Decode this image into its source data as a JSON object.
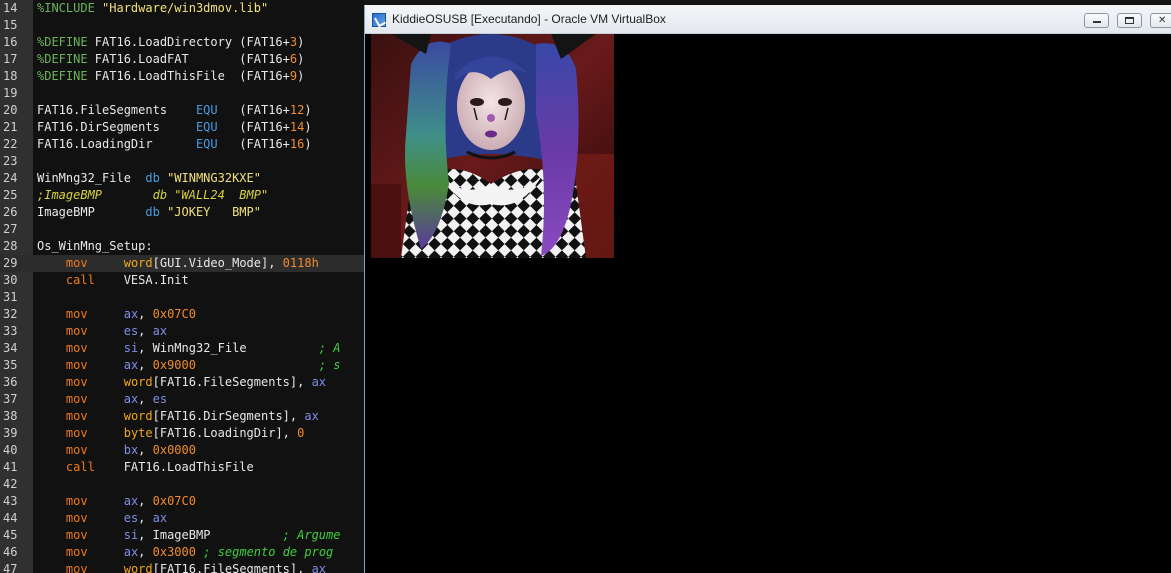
{
  "editor": {
    "lines": [
      {
        "num": "14",
        "current": false,
        "tokens": [
          {
            "t": "%INCLUDE",
            "c": "t-dir"
          },
          {
            "t": " ",
            "c": "t-plain"
          },
          {
            "t": "\"Hardware/win3dmov.lib\"",
            "c": "t-str"
          }
        ]
      },
      {
        "num": "15",
        "current": false,
        "tokens": []
      },
      {
        "num": "16",
        "current": false,
        "tokens": [
          {
            "t": "%DEFINE",
            "c": "t-dir"
          },
          {
            "t": " FAT16.LoadDirectory (FAT16+",
            "c": "t-plain"
          },
          {
            "t": "3",
            "c": "t-num"
          },
          {
            "t": ")",
            "c": "t-plain"
          }
        ]
      },
      {
        "num": "17",
        "current": false,
        "tokens": [
          {
            "t": "%DEFINE",
            "c": "t-dir"
          },
          {
            "t": " FAT16.LoadFAT       (FAT16+",
            "c": "t-plain"
          },
          {
            "t": "6",
            "c": "t-num"
          },
          {
            "t": ")",
            "c": "t-plain"
          }
        ]
      },
      {
        "num": "18",
        "current": false,
        "tokens": [
          {
            "t": "%DEFINE",
            "c": "t-dir"
          },
          {
            "t": " FAT16.LoadThisFile  (FAT16+",
            "c": "t-plain"
          },
          {
            "t": "9",
            "c": "t-num"
          },
          {
            "t": ")",
            "c": "t-plain"
          }
        ]
      },
      {
        "num": "19",
        "current": false,
        "tokens": []
      },
      {
        "num": "20",
        "current": false,
        "tokens": [
          {
            "t": "FAT16.FileSegments    ",
            "c": "t-plain"
          },
          {
            "t": "EQU",
            "c": "t-kw"
          },
          {
            "t": "   (FAT16+",
            "c": "t-plain"
          },
          {
            "t": "12",
            "c": "t-num"
          },
          {
            "t": ")",
            "c": "t-plain"
          }
        ]
      },
      {
        "num": "21",
        "current": false,
        "tokens": [
          {
            "t": "FAT16.DirSegments     ",
            "c": "t-plain"
          },
          {
            "t": "EQU",
            "c": "t-kw"
          },
          {
            "t": "   (FAT16+",
            "c": "t-plain"
          },
          {
            "t": "14",
            "c": "t-num"
          },
          {
            "t": ")",
            "c": "t-plain"
          }
        ]
      },
      {
        "num": "22",
        "current": false,
        "tokens": [
          {
            "t": "FAT16.LoadingDir      ",
            "c": "t-plain"
          },
          {
            "t": "EQU",
            "c": "t-kw"
          },
          {
            "t": "   (FAT16+",
            "c": "t-plain"
          },
          {
            "t": "16",
            "c": "t-num"
          },
          {
            "t": ")",
            "c": "t-plain"
          }
        ]
      },
      {
        "num": "23",
        "current": false,
        "tokens": []
      },
      {
        "num": "24",
        "current": false,
        "tokens": [
          {
            "t": "WinMng32_File  ",
            "c": "t-plain"
          },
          {
            "t": "db",
            "c": "t-kw"
          },
          {
            "t": " ",
            "c": "t-plain"
          },
          {
            "t": "\"WINMNG32KXE\"",
            "c": "t-str"
          }
        ]
      },
      {
        "num": "25",
        "current": false,
        "tokens": [
          {
            "t": ";ImageBMP       db \"WALL24  BMP\"",
            "c": "t-icmt"
          }
        ]
      },
      {
        "num": "26",
        "current": false,
        "tokens": [
          {
            "t": "ImageBMP       ",
            "c": "t-plain"
          },
          {
            "t": "db",
            "c": "t-kw"
          },
          {
            "t": " ",
            "c": "t-plain"
          },
          {
            "t": "\"JOKEY   BMP\"",
            "c": "t-str"
          }
        ]
      },
      {
        "num": "27",
        "current": false,
        "tokens": []
      },
      {
        "num": "28",
        "current": false,
        "tokens": [
          {
            "t": "Os_WinMng_Setup:",
            "c": "t-plain"
          }
        ]
      },
      {
        "num": "29",
        "current": true,
        "tokens": [
          {
            "t": "    ",
            "c": "t-plain"
          },
          {
            "t": "mov",
            "c": "t-op"
          },
          {
            "t": "     ",
            "c": "t-plain"
          },
          {
            "t": "word",
            "c": "t-word"
          },
          {
            "t": "[GUI.Video_Mode], ",
            "c": "t-plain"
          },
          {
            "t": "0118h",
            "c": "t-num"
          }
        ]
      },
      {
        "num": "30",
        "current": false,
        "tokens": [
          {
            "t": "    ",
            "c": "t-plain"
          },
          {
            "t": "call",
            "c": "t-op"
          },
          {
            "t": "    VESA.Init",
            "c": "t-plain"
          }
        ]
      },
      {
        "num": "31",
        "current": false,
        "tokens": []
      },
      {
        "num": "32",
        "current": false,
        "tokens": [
          {
            "t": "    ",
            "c": "t-plain"
          },
          {
            "t": "mov",
            "c": "t-op"
          },
          {
            "t": "     ",
            "c": "t-plain"
          },
          {
            "t": "ax",
            "c": "t-reg"
          },
          {
            "t": ", ",
            "c": "t-plain"
          },
          {
            "t": "0x07C0",
            "c": "t-num"
          }
        ]
      },
      {
        "num": "33",
        "current": false,
        "tokens": [
          {
            "t": "    ",
            "c": "t-plain"
          },
          {
            "t": "mov",
            "c": "t-op"
          },
          {
            "t": "     ",
            "c": "t-plain"
          },
          {
            "t": "es",
            "c": "t-reg"
          },
          {
            "t": ", ",
            "c": "t-plain"
          },
          {
            "t": "ax",
            "c": "t-reg"
          }
        ]
      },
      {
        "num": "34",
        "current": false,
        "tokens": [
          {
            "t": "    ",
            "c": "t-plain"
          },
          {
            "t": "mov",
            "c": "t-op"
          },
          {
            "t": "     ",
            "c": "t-plain"
          },
          {
            "t": "si",
            "c": "t-reg"
          },
          {
            "t": ", WinMng32_File          ",
            "c": "t-plain"
          },
          {
            "t": "; A",
            "c": "t-cmt"
          }
        ]
      },
      {
        "num": "35",
        "current": false,
        "tokens": [
          {
            "t": "    ",
            "c": "t-plain"
          },
          {
            "t": "mov",
            "c": "t-op"
          },
          {
            "t": "     ",
            "c": "t-plain"
          },
          {
            "t": "ax",
            "c": "t-reg"
          },
          {
            "t": ", ",
            "c": "t-plain"
          },
          {
            "t": "0x9000",
            "c": "t-num"
          },
          {
            "t": "                 ",
            "c": "t-plain"
          },
          {
            "t": "; s",
            "c": "t-cmt"
          }
        ]
      },
      {
        "num": "36",
        "current": false,
        "tokens": [
          {
            "t": "    ",
            "c": "t-plain"
          },
          {
            "t": "mov",
            "c": "t-op"
          },
          {
            "t": "     ",
            "c": "t-plain"
          },
          {
            "t": "word",
            "c": "t-word"
          },
          {
            "t": "[FAT16.FileSegments], ",
            "c": "t-plain"
          },
          {
            "t": "ax",
            "c": "t-reg"
          }
        ]
      },
      {
        "num": "37",
        "current": false,
        "tokens": [
          {
            "t": "    ",
            "c": "t-plain"
          },
          {
            "t": "mov",
            "c": "t-op"
          },
          {
            "t": "     ",
            "c": "t-plain"
          },
          {
            "t": "ax",
            "c": "t-reg"
          },
          {
            "t": ", ",
            "c": "t-plain"
          },
          {
            "t": "es",
            "c": "t-reg"
          }
        ]
      },
      {
        "num": "38",
        "current": false,
        "tokens": [
          {
            "t": "    ",
            "c": "t-plain"
          },
          {
            "t": "mov",
            "c": "t-op"
          },
          {
            "t": "     ",
            "c": "t-plain"
          },
          {
            "t": "word",
            "c": "t-word"
          },
          {
            "t": "[FAT16.DirSegments], ",
            "c": "t-plain"
          },
          {
            "t": "ax",
            "c": "t-reg"
          }
        ]
      },
      {
        "num": "39",
        "current": false,
        "tokens": [
          {
            "t": "    ",
            "c": "t-plain"
          },
          {
            "t": "mov",
            "c": "t-op"
          },
          {
            "t": "     ",
            "c": "t-plain"
          },
          {
            "t": "byte",
            "c": "t-word"
          },
          {
            "t": "[FAT16.LoadingDir], ",
            "c": "t-plain"
          },
          {
            "t": "0",
            "c": "t-num"
          }
        ]
      },
      {
        "num": "40",
        "current": false,
        "tokens": [
          {
            "t": "    ",
            "c": "t-plain"
          },
          {
            "t": "mov",
            "c": "t-op"
          },
          {
            "t": "     ",
            "c": "t-plain"
          },
          {
            "t": "bx",
            "c": "t-reg"
          },
          {
            "t": ", ",
            "c": "t-plain"
          },
          {
            "t": "0x0000",
            "c": "t-num"
          }
        ]
      },
      {
        "num": "41",
        "current": false,
        "tokens": [
          {
            "t": "    ",
            "c": "t-plain"
          },
          {
            "t": "call",
            "c": "t-op"
          },
          {
            "t": "    FAT16.LoadThisFile",
            "c": "t-plain"
          }
        ]
      },
      {
        "num": "42",
        "current": false,
        "tokens": []
      },
      {
        "num": "43",
        "current": false,
        "tokens": [
          {
            "t": "    ",
            "c": "t-plain"
          },
          {
            "t": "mov",
            "c": "t-op"
          },
          {
            "t": "     ",
            "c": "t-plain"
          },
          {
            "t": "ax",
            "c": "t-reg"
          },
          {
            "t": ", ",
            "c": "t-plain"
          },
          {
            "t": "0x07C0",
            "c": "t-num"
          }
        ]
      },
      {
        "num": "44",
        "current": false,
        "tokens": [
          {
            "t": "    ",
            "c": "t-plain"
          },
          {
            "t": "mov",
            "c": "t-op"
          },
          {
            "t": "     ",
            "c": "t-plain"
          },
          {
            "t": "es",
            "c": "t-reg"
          },
          {
            "t": ", ",
            "c": "t-plain"
          },
          {
            "t": "ax",
            "c": "t-reg"
          }
        ]
      },
      {
        "num": "45",
        "current": false,
        "tokens": [
          {
            "t": "    ",
            "c": "t-plain"
          },
          {
            "t": "mov",
            "c": "t-op"
          },
          {
            "t": "     ",
            "c": "t-plain"
          },
          {
            "t": "si",
            "c": "t-reg"
          },
          {
            "t": ", ImageBMP          ",
            "c": "t-plain"
          },
          {
            "t": "; Argume",
            "c": "t-cmt"
          }
        ]
      },
      {
        "num": "46",
        "current": false,
        "tokens": [
          {
            "t": "    ",
            "c": "t-plain"
          },
          {
            "t": "mov",
            "c": "t-op"
          },
          {
            "t": "     ",
            "c": "t-plain"
          },
          {
            "t": "ax",
            "c": "t-reg"
          },
          {
            "t": ", ",
            "c": "t-plain"
          },
          {
            "t": "0x3000",
            "c": "t-num"
          },
          {
            "t": " ",
            "c": "t-plain"
          },
          {
            "t": "; segmento de prog",
            "c": "t-cmt"
          }
        ]
      },
      {
        "num": "47",
        "current": false,
        "tokens": [
          {
            "t": "    ",
            "c": "t-plain"
          },
          {
            "t": "mov",
            "c": "t-op"
          },
          {
            "t": "     ",
            "c": "t-plain"
          },
          {
            "t": "word",
            "c": "t-word"
          },
          {
            "t": "[FAT16.FileSegments], ",
            "c": "t-plain"
          },
          {
            "t": "ax",
            "c": "t-reg"
          }
        ]
      }
    ]
  },
  "vbox": {
    "title": "KiddieOSUSB [Executando] - Oracle VM VirtualBox",
    "icon": "virtualbox-logo-icon",
    "buttons": {
      "minimize_icon": "minimize-icon",
      "maximize_icon": "maximize-icon",
      "close_icon": "close-icon",
      "close_glyph": "✕"
    }
  },
  "guest": {
    "image": "clown-portrait-image"
  }
}
